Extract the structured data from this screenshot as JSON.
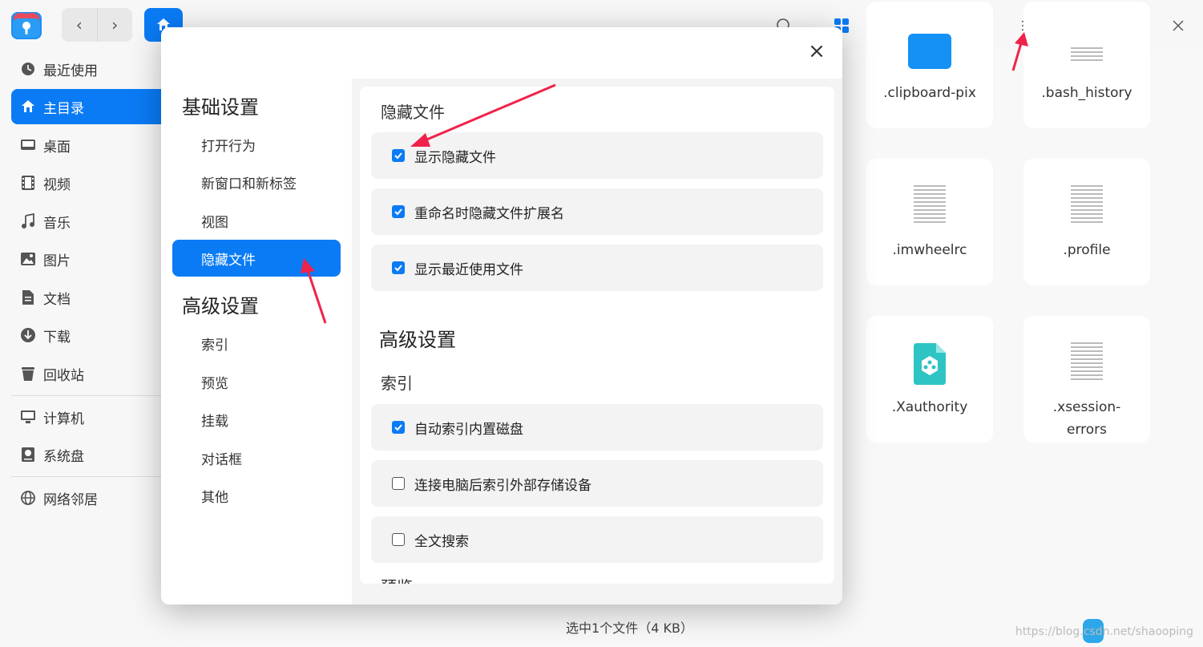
{
  "window": {
    "nav_back": "‹",
    "nav_forward": "›"
  },
  "sidebar": {
    "items": [
      {
        "label": "最近使用",
        "icon": "clock-icon"
      },
      {
        "label": "主目录",
        "icon": "home-icon",
        "active": true
      },
      {
        "label": "桌面",
        "icon": "desktop-icon"
      },
      {
        "label": "视频",
        "icon": "video-icon"
      },
      {
        "label": "音乐",
        "icon": "music-icon"
      },
      {
        "label": "图片",
        "icon": "picture-icon"
      },
      {
        "label": "文档",
        "icon": "document-icon"
      },
      {
        "label": "下载",
        "icon": "download-icon"
      },
      {
        "label": "回收站",
        "icon": "trash-icon"
      },
      {
        "label": "计算机",
        "icon": "computer-icon"
      },
      {
        "label": "系统盘",
        "icon": "disk-icon"
      },
      {
        "label": "网络邻居",
        "icon": "network-icon"
      }
    ]
  },
  "files": [
    {
      "name": ".clipboard-pix"
    },
    {
      "name": ".bash_history"
    },
    {
      "name": ".imwheelrc"
    },
    {
      "name": ".profile"
    },
    {
      "name": ".Xauthority"
    },
    {
      "name": ".xsession-errors"
    }
  ],
  "status": {
    "text": "选中1个文件（4 KB）",
    "watermark": "https://blog.csdn.net/shaooping"
  },
  "dialog": {
    "close_label": "×",
    "nav": {
      "basic_title": "基础设置",
      "basic_items": [
        "打开行为",
        "新窗口和新标签",
        "视图",
        "隐藏文件"
      ],
      "advanced_title": "高级设置",
      "advanced_items": [
        "索引",
        "预览",
        "挂载",
        "对话框",
        "其他"
      ]
    },
    "content": {
      "hidden_section": "隐藏文件",
      "hidden_options": [
        {
          "label": "显示隐藏文件",
          "checked": true
        },
        {
          "label": "重命名时隐藏文件扩展名",
          "checked": true
        },
        {
          "label": "显示最近使用文件",
          "checked": true
        }
      ],
      "advanced_title": "高级设置",
      "index_section": "索引",
      "index_options": [
        {
          "label": "自动索引内置磁盘",
          "checked": true
        },
        {
          "label": "连接电脑后索引外部存储设备",
          "checked": false
        },
        {
          "label": "全文搜索",
          "checked": false
        }
      ],
      "preview_section": "预览"
    }
  },
  "colors": {
    "accent": "#0a7bf5",
    "arrow": "#f0224a"
  }
}
